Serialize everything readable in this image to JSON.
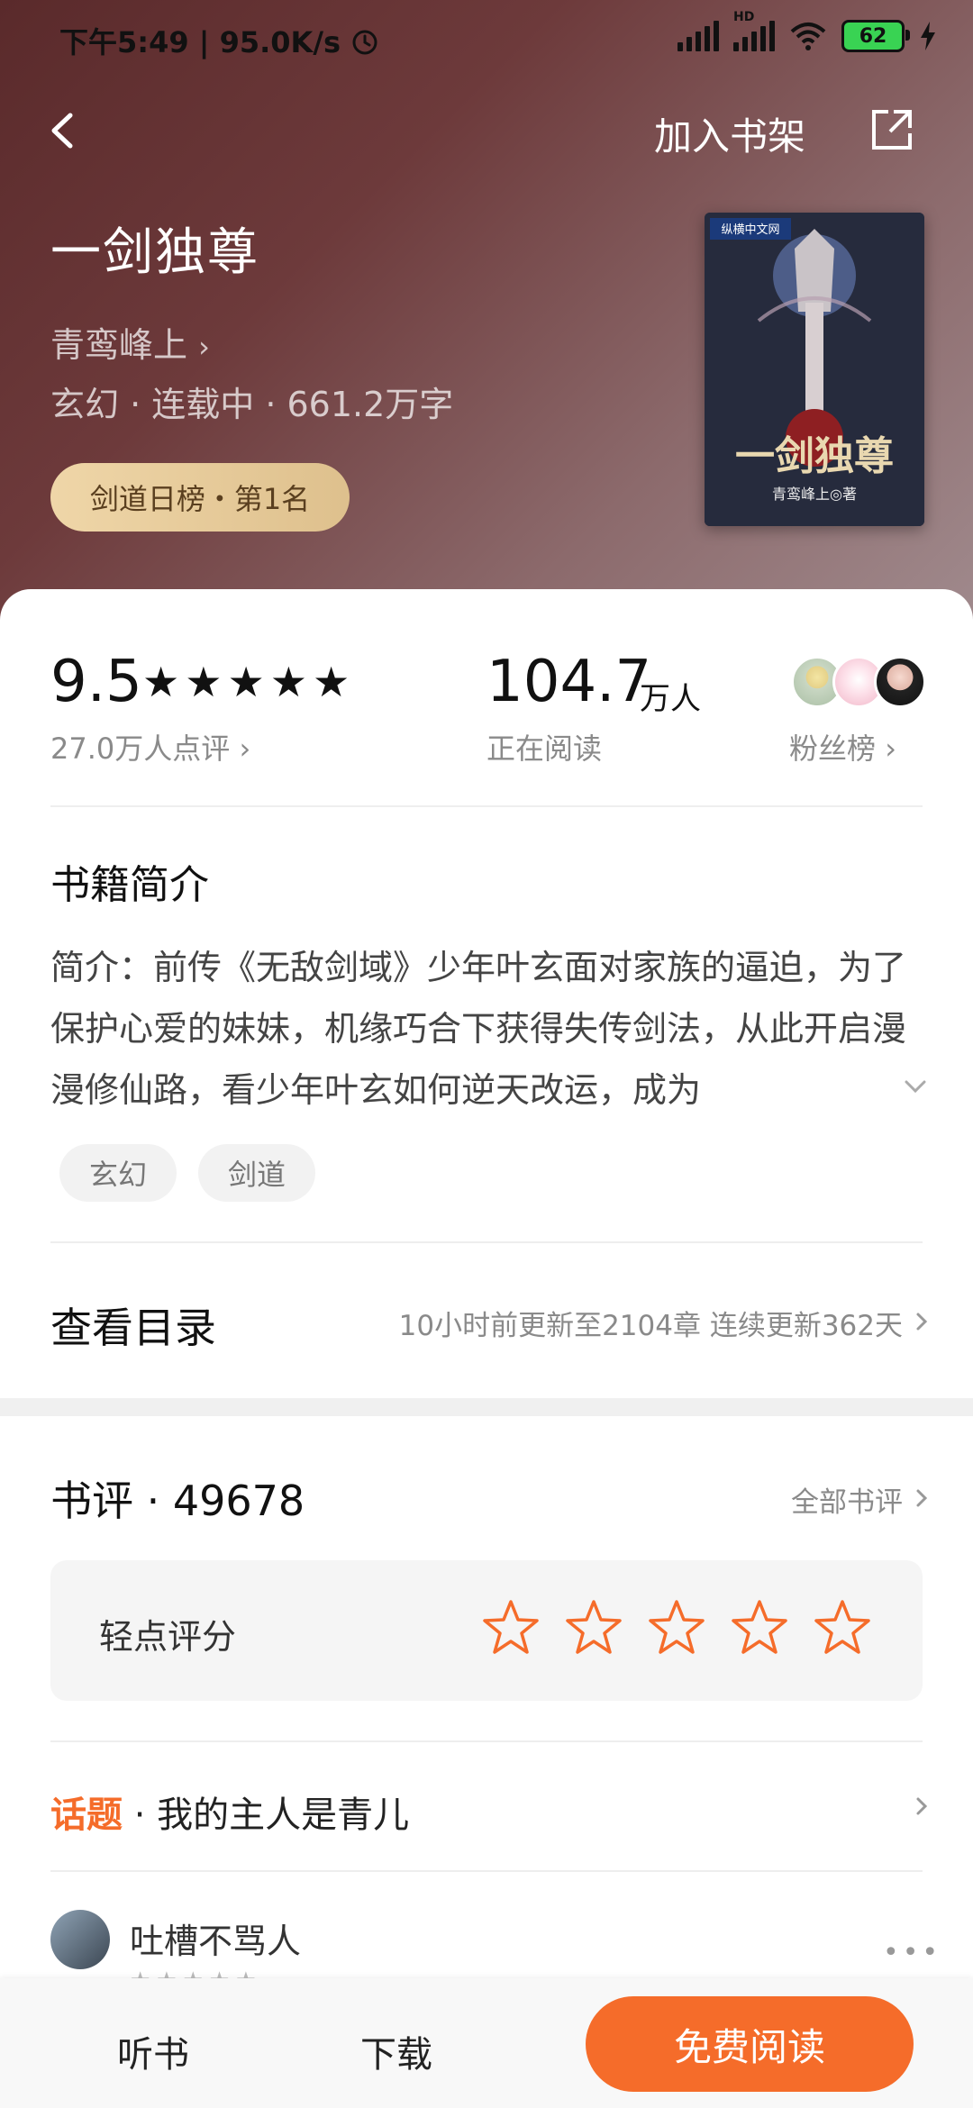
{
  "status_bar": {
    "time_speed": "下午5:49 | 95.0K/s",
    "battery": "62",
    "hd_label": "HD"
  },
  "header": {
    "add_to_shelf": "加入书架"
  },
  "book": {
    "title": "一剑独尊",
    "author": "青鸾峰上",
    "meta": "玄幻 · 连载中 · 661.2万字",
    "rank_badge": "剑道日榜・第1名",
    "cover_title": "一剑独尊",
    "cover_author": "青鸾峰上◎著",
    "cover_publisher": "纵横中文网"
  },
  "stats": {
    "score": "9.5",
    "stars": "★★★★★",
    "rating_count": "27.0万人点评",
    "readers": "104.7",
    "readers_unit": "万人",
    "readers_label": "正在阅读",
    "fans_label": "粉丝榜"
  },
  "intro": {
    "heading": "书籍简介",
    "text": "简介：前传《无敌剑域》少年叶玄面对家族的逼迫，为了保护心爱的妹妹，机缘巧合下获得失传剑法，从此开启漫漫修仙路，看少年叶玄如何逆天改运，成为",
    "tags": [
      "玄幻",
      "剑道"
    ]
  },
  "toc": {
    "label": "查看目录",
    "info": "10小时前更新至2104章 连续更新362天"
  },
  "reviews": {
    "title": "书评 · 49678",
    "all_label": "全部书评",
    "rate_label": "轻点评分",
    "topic_highlight": "话题",
    "topic_text": " · 我的主人是青儿",
    "first_review_user": "吐槽不骂人",
    "first_review_stars": "★★★★★",
    "more": "•••"
  },
  "bottom_bar": {
    "listen": "听书",
    "download": "下载",
    "read": "免费阅读"
  },
  "colors": {
    "accent": "#f56c2a",
    "badge_gold": "#e8cc98",
    "hero_dark": "#5a2a2b"
  }
}
